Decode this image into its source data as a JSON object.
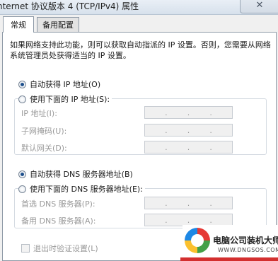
{
  "window": {
    "title": "nternet 协议版本 4 (TCP/IPv4) 属性",
    "close_glyph": "✕"
  },
  "tabs": [
    {
      "label": "常规"
    },
    {
      "label": "备用配置"
    }
  ],
  "description": "如果网络支持此功能，则可以获取自动指派的 IP 设置。否则，您需要从网络系统管理员处获得适当的 IP 设置。",
  "ip": {
    "auto_label": "自动获得 IP 地址(O)",
    "manual_label": "使用下面的 IP 地址(S):",
    "selected": "auto",
    "fields": [
      {
        "label": "IP 地址(I):"
      },
      {
        "label": "子网掩码(U):"
      },
      {
        "label": "默认网关(D):"
      }
    ]
  },
  "dns": {
    "auto_label": "自动获得 DNS 服务器地址(B)",
    "manual_label": "使用下面的 DNS 服务器地址(E):",
    "selected": "auto",
    "fields": [
      {
        "label": "首选 DNS 服务器(P):"
      },
      {
        "label": "备用 DNS 服务器(A):"
      }
    ]
  },
  "validate_on_exit": {
    "label": "退出时验证设置(L)",
    "checked": false
  },
  "ip_box_dots": ".",
  "watermark": {
    "brand": "电脑公司装机大师",
    "url": "WWW.DNGSOS.COM"
  }
}
